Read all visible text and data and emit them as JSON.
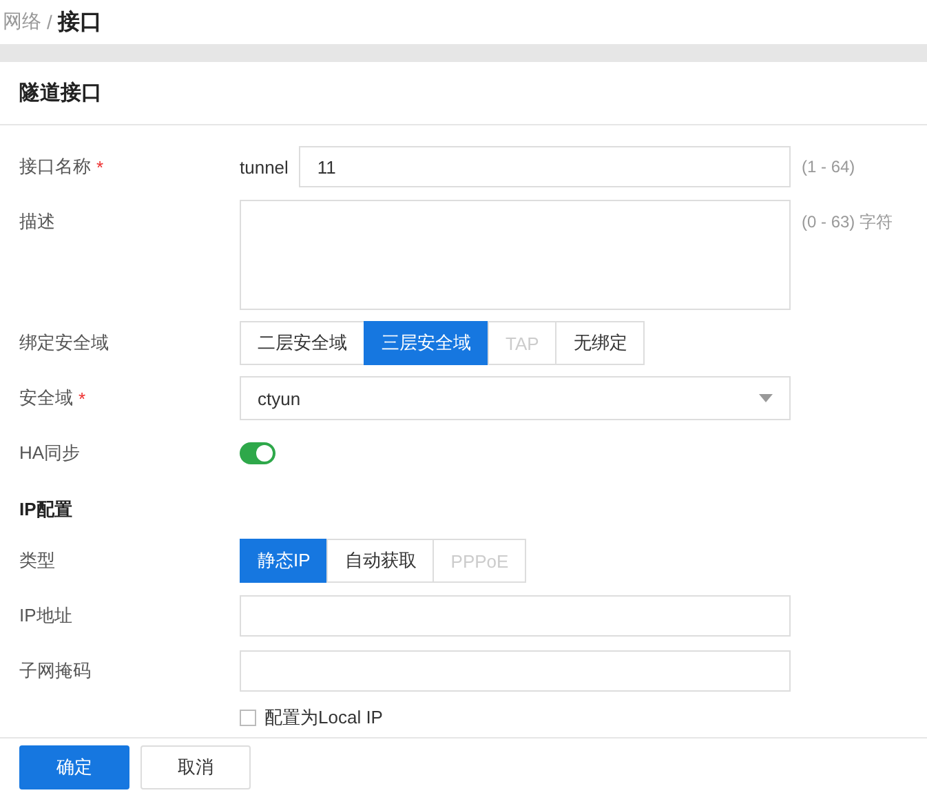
{
  "breadcrumb": {
    "parent": "网络",
    "separator": "/",
    "current": "接口"
  },
  "panel_title": "隧道接口",
  "fields": [
    {
      "kind": "text",
      "label": "接口名称",
      "required_mark": "*",
      "prefix": "tunnel",
      "value": "11",
      "hint": "(1 - 64)"
    },
    {
      "kind": "textarea",
      "label": "描述",
      "hint": "(0 - 63) 字符"
    },
    {
      "kind": "segmented",
      "label": "绑定安全域",
      "options": [
        {
          "label": "二层安全域",
          "selected": false,
          "disabled": false
        },
        {
          "label": "三层安全域",
          "selected": true,
          "disabled": false
        },
        {
          "label": "TAP",
          "selected": false,
          "disabled": true
        },
        {
          "label": "无绑定",
          "selected": false,
          "disabled": false
        }
      ]
    },
    {
      "kind": "select",
      "label": "安全域",
      "required_mark": "*",
      "value": "ctyun"
    },
    {
      "kind": "toggle",
      "label": "HA同步",
      "on": true
    },
    {
      "kind": "section",
      "label": "IP配置"
    },
    {
      "kind": "segmented",
      "label": "类型",
      "options": [
        {
          "label": "静态IP",
          "selected": true,
          "disabled": false
        },
        {
          "label": "自动获取",
          "selected": false,
          "disabled": false
        },
        {
          "label": "PPPoE",
          "selected": false,
          "disabled": true
        }
      ]
    },
    {
      "kind": "text",
      "label": "IP地址"
    },
    {
      "kind": "text",
      "label": "子网掩码"
    },
    {
      "kind": "checkbox",
      "text": "配置为Local IP",
      "checked": false
    }
  ],
  "buttons": [
    {
      "label": "确定",
      "primary": true
    },
    {
      "label": "取消",
      "primary": false
    }
  ]
}
